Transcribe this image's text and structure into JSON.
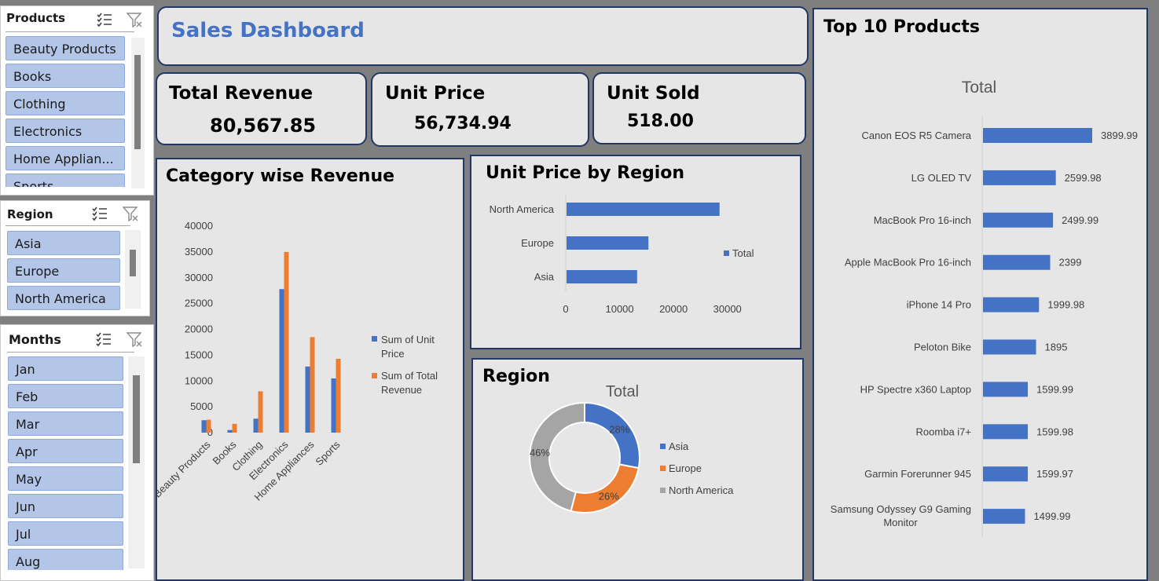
{
  "colors": {
    "accent": "#4472c4",
    "orange": "#ed7d31",
    "gray": "#a5a5a5",
    "panel_bg": "#e7e6e6",
    "border": "#1f3864",
    "slicer_item": "#b4c6e7"
  },
  "slicers": {
    "products": {
      "title": "Products",
      "items": [
        "Beauty Products",
        "Books",
        "Clothing",
        "Electronics",
        "Home Applian...",
        "Sports"
      ]
    },
    "region": {
      "title": "Region",
      "items": [
        "Asia",
        "Europe",
        "North America"
      ]
    },
    "months": {
      "title": "Months",
      "items": [
        "Jan",
        "Feb",
        "Mar",
        "Apr",
        "May",
        "Jun",
        "Jul",
        "Aug"
      ]
    },
    "icons": {
      "multiselect": "multi-select-icon",
      "clear_filter": "clear-filter-icon"
    }
  },
  "header": {
    "title": "Sales Dashboard"
  },
  "kpis": [
    {
      "label": "Total Revenue",
      "value": "80,567.85"
    },
    {
      "label": "Unit Price",
      "value": "56,734.94"
    },
    {
      "label": "Unit Sold",
      "value": "518.00"
    }
  ],
  "panels": {
    "category": {
      "title": "Category wise Revenue"
    },
    "unit_price_region": {
      "title": "Unit Price by Region"
    },
    "region": {
      "title": "Region"
    },
    "top10": {
      "title": "Top 10 Products"
    }
  },
  "chart_data": [
    {
      "type": "bar",
      "title": "Category wise Revenue",
      "categories": [
        "Beauty Products",
        "Books",
        "Clothing",
        "Electronics",
        "Home Appliances",
        "Sports"
      ],
      "series": [
        {
          "name": "Sum of Unit Price",
          "values": [
            2400,
            500,
            2700,
            27800,
            12800,
            10500
          ]
        },
        {
          "name": "Sum of Total Revenue",
          "values": [
            2500,
            1700,
            8000,
            35000,
            18500,
            14300
          ]
        }
      ],
      "ylim": [
        0,
        40000
      ],
      "yticks": [
        "0",
        "5000",
        "10000",
        "15000",
        "20000",
        "25000",
        "30000",
        "35000",
        "40000"
      ],
      "legend": [
        "Sum of Unit",
        "Price",
        "Sum of Total",
        "Revenue"
      ],
      "legend_position": "right"
    },
    {
      "type": "bar",
      "orientation": "horizontal",
      "title": "Unit Price by Region",
      "categories": [
        "North America",
        "Europe",
        "Asia"
      ],
      "series": [
        {
          "name": "Total",
          "values": [
            28400,
            15200,
            13100
          ]
        }
      ],
      "xlim": [
        0,
        35000
      ],
      "xticks": [
        "0",
        "10000",
        "20000",
        "30000"
      ],
      "legend_position": "right"
    },
    {
      "type": "pie",
      "donut": true,
      "title": "Total",
      "labels": [
        "Asia",
        "Europe",
        "North America"
      ],
      "values": [
        28,
        26,
        46
      ],
      "value_labels": [
        "28%",
        "26%",
        "46%"
      ],
      "legend_position": "right"
    },
    {
      "type": "bar",
      "orientation": "horizontal",
      "title": "Total",
      "categories": [
        "Canon EOS R5 Camera",
        "LG OLED TV",
        "MacBook Pro 16-inch",
        "Apple MacBook Pro 16-inch",
        "iPhone 14 Pro",
        "Peloton Bike",
        "HP Spectre x360 Laptop",
        "Roomba i7+",
        "Garmin Forerunner 945",
        "Samsung Odyssey G9 Gaming Monitor"
      ],
      "category_lines": [
        [
          "Canon EOS R5 Camera"
        ],
        [
          "LG OLED TV"
        ],
        [
          "MacBook Pro 16-inch"
        ],
        [
          "Apple MacBook Pro 16-inch"
        ],
        [
          "iPhone 14 Pro"
        ],
        [
          "Peloton Bike"
        ],
        [
          "HP Spectre x360 Laptop"
        ],
        [
          "Roomba i7+"
        ],
        [
          "Garmin Forerunner 945"
        ],
        [
          "Samsung Odyssey G9 Gaming",
          "Monitor"
        ]
      ],
      "values": [
        3899.99,
        2599.98,
        2499.99,
        2399,
        1999.98,
        1895,
        1599.99,
        1599.98,
        1599.97,
        1499.99
      ],
      "value_labels": [
        "3899.99",
        "2599.98",
        "2499.99",
        "2399",
        "1999.98",
        "1895",
        "1599.99",
        "1599.98",
        "1599.97",
        "1499.99"
      ],
      "xlim": [
        0,
        3899.99
      ]
    }
  ]
}
